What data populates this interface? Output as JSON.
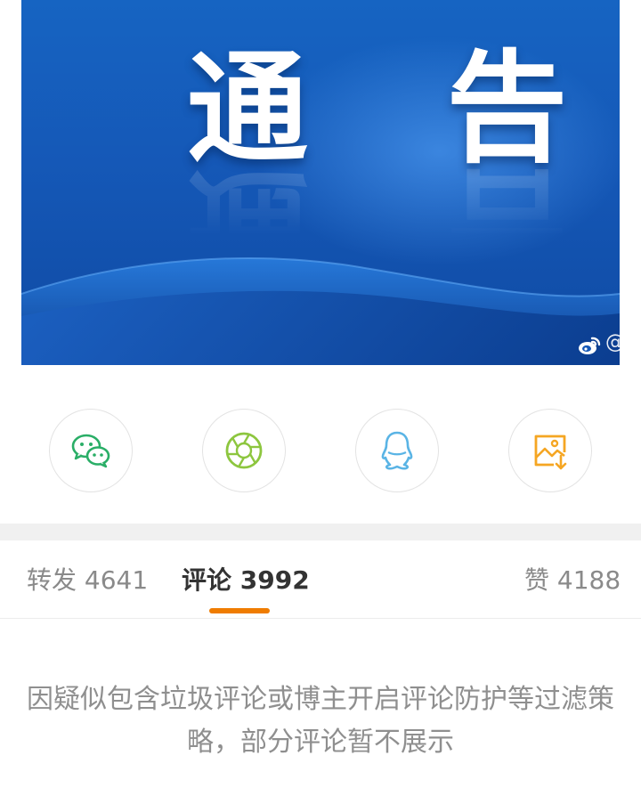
{
  "banner": {
    "title": "通 告",
    "watermark": "@"
  },
  "share": [
    {
      "icon": "wechat-icon",
      "color": "#2aae67"
    },
    {
      "icon": "moments-icon",
      "color": "#8dc63f"
    },
    {
      "icon": "qq-icon",
      "color": "#5ab4e5"
    },
    {
      "icon": "save-image-icon",
      "color": "#f5a623"
    }
  ],
  "tabs": {
    "repost": "转发 4641",
    "comments": "评论 3992",
    "likes": "赞 4188",
    "active": "comments",
    "accent": "#ef7c00"
  },
  "notice": {
    "line1": "因疑似包含垃圾评论或博主开启评论防护等过滤策",
    "line2": "略，部分评论暂不展示"
  }
}
